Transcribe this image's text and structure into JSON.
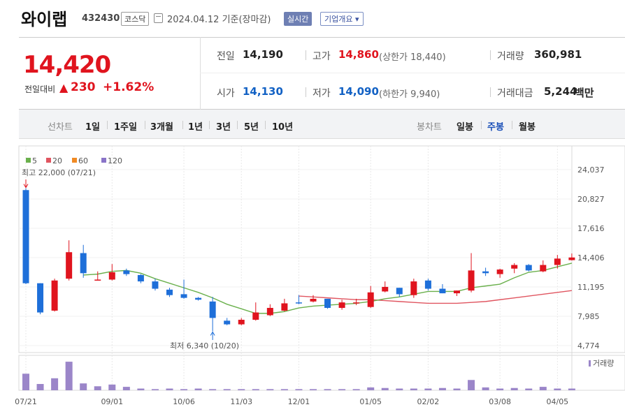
{
  "header": {
    "company": "와이랩",
    "code": "432430",
    "market": "코스닥",
    "date": "2024.04.12 기준(장마감)",
    "realtime": "실시간",
    "overview": "기업개요 ▾"
  },
  "quote": {
    "price": "14,420",
    "change_label": "전일대비",
    "change_arrow": "▲",
    "change": "230",
    "change_pct": "+1.62%",
    "prev_close_label": "전일",
    "prev_close": "14,190",
    "high_label": "고가",
    "high": "14,860",
    "upper_limit": "(상한가 18,440)",
    "volume_label": "거래량",
    "volume": "360,981",
    "open_label": "시가",
    "open": "14,130",
    "low_label": "저가",
    "low": "14,090",
    "lower_limit": "(하한가 9,940)",
    "amount_label": "거래대금",
    "amount": "5,244",
    "amount_unit": "백만"
  },
  "periods": {
    "line_label": "선차트",
    "items": [
      "1일",
      "1주일",
      "3개월",
      "1년",
      "3년",
      "5년",
      "10년"
    ],
    "candle_label": "봉차트",
    "candle_items": [
      "일봉",
      "주봉",
      "월봉"
    ],
    "active_candle": "주봉"
  },
  "colors": {
    "up": "#e0141e",
    "down": "#1e6fd9",
    "ma5": "#6ab04c",
    "ma20": "#e05560",
    "ma60": "#f08a24",
    "ma120": "#8a74c8",
    "volume": "#9b86c9"
  },
  "chart_data": {
    "type": "candlestick",
    "legend": [
      "5",
      "20",
      "60",
      "120"
    ],
    "y_ticks": [
      "24,037",
      "20,827",
      "17,616",
      "14,406",
      "11,195",
      "7,985",
      "4,774"
    ],
    "y_tick_values": [
      24037,
      20827,
      17616,
      14406,
      11195,
      7985,
      4774
    ],
    "x_tick_labels": [
      "07/21",
      "09/01",
      "10/06",
      "11/03",
      "12/01",
      "01/05",
      "02/02",
      "03/08",
      "04/05"
    ],
    "x_tick_index": [
      0,
      6,
      11,
      15,
      19,
      24,
      28,
      33,
      37
    ],
    "high_annotation": "최고 22,000 (07/21)",
    "low_annotation": "최저 6,340 (10/20)",
    "volume_label": "거래량",
    "candles": [
      {
        "o": 21800,
        "h": 22000,
        "l": 11500,
        "c": 11600
      },
      {
        "o": 11600,
        "h": 11600,
        "l": 8200,
        "c": 8400
      },
      {
        "o": 8600,
        "h": 12100,
        "l": 8500,
        "c": 11900
      },
      {
        "o": 12100,
        "h": 16300,
        "l": 11900,
        "c": 15000
      },
      {
        "o": 14900,
        "h": 15800,
        "l": 12200,
        "c": 12700
      },
      {
        "o": 12000,
        "h": 12900,
        "l": 11900,
        "c": 12000
      },
      {
        "o": 12000,
        "h": 13700,
        "l": 11900,
        "c": 12800
      },
      {
        "o": 13000,
        "h": 13200,
        "l": 12400,
        "c": 12600
      },
      {
        "o": 12500,
        "h": 12600,
        "l": 11600,
        "c": 11800
      },
      {
        "o": 11800,
        "h": 12100,
        "l": 10800,
        "c": 11000
      },
      {
        "o": 10900,
        "h": 11100,
        "l": 10100,
        "c": 10300
      },
      {
        "o": 10400,
        "h": 12000,
        "l": 9900,
        "c": 10000
      },
      {
        "o": 10000,
        "h": 10100,
        "l": 9700,
        "c": 9800
      },
      {
        "o": 9600,
        "h": 10100,
        "l": 6340,
        "c": 7800
      },
      {
        "o": 7500,
        "h": 7800,
        "l": 7000,
        "c": 7100
      },
      {
        "o": 7100,
        "h": 7800,
        "l": 7000,
        "c": 7600
      },
      {
        "o": 7600,
        "h": 9500,
        "l": 7500,
        "c": 8400
      },
      {
        "o": 8100,
        "h": 9300,
        "l": 8000,
        "c": 8900
      },
      {
        "o": 8600,
        "h": 9900,
        "l": 8500,
        "c": 9400
      },
      {
        "o": 9500,
        "h": 10300,
        "l": 9300,
        "c": 9400
      },
      {
        "o": 9600,
        "h": 10300,
        "l": 9500,
        "c": 9900
      },
      {
        "o": 9900,
        "h": 9900,
        "l": 8800,
        "c": 8900
      },
      {
        "o": 8900,
        "h": 9800,
        "l": 8700,
        "c": 9500
      },
      {
        "o": 9400,
        "h": 9900,
        "l": 9200,
        "c": 9500
      },
      {
        "o": 9000,
        "h": 11300,
        "l": 8900,
        "c": 10600
      },
      {
        "o": 10700,
        "h": 11800,
        "l": 10600,
        "c": 11200
      },
      {
        "o": 11100,
        "h": 11100,
        "l": 10100,
        "c": 10400
      },
      {
        "o": 10300,
        "h": 12100,
        "l": 10000,
        "c": 11800
      },
      {
        "o": 11900,
        "h": 12100,
        "l": 10800,
        "c": 11000
      },
      {
        "o": 11000,
        "h": 11500,
        "l": 10500,
        "c": 10500
      },
      {
        "o": 10500,
        "h": 10800,
        "l": 10200,
        "c": 10800
      },
      {
        "o": 10800,
        "h": 14900,
        "l": 10600,
        "c": 13000
      },
      {
        "o": 12900,
        "h": 13300,
        "l": 12400,
        "c": 12700
      },
      {
        "o": 12600,
        "h": 13200,
        "l": 12200,
        "c": 13100
      },
      {
        "o": 13200,
        "h": 13800,
        "l": 12700,
        "c": 13600
      },
      {
        "o": 13600,
        "h": 13700,
        "l": 12900,
        "c": 13000
      },
      {
        "o": 12900,
        "h": 14100,
        "l": 12800,
        "c": 13600
      },
      {
        "o": 13600,
        "h": 14700,
        "l": 13200,
        "c": 14300
      },
      {
        "o": 14130,
        "h": 14860,
        "l": 14090,
        "c": 14420
      }
    ],
    "ma5": [
      null,
      null,
      null,
      null,
      12500,
      12600,
      12900,
      13000,
      12700,
      12100,
      11600,
      11100,
      10600,
      10000,
      9300,
      8800,
      8300,
      8300,
      8500,
      8900,
      9100,
      9200,
      9300,
      9400,
      9600,
      9900,
      10100,
      10400,
      10700,
      10700,
      10700,
      11100,
      11300,
      11500,
      12200,
      12800,
      13000,
      13400,
      13800
    ],
    "ma20": [
      null,
      null,
      null,
      null,
      null,
      null,
      null,
      null,
      null,
      null,
      null,
      null,
      null,
      null,
      null,
      null,
      null,
      null,
      null,
      10200,
      10100,
      10000,
      9900,
      9800,
      9800,
      9700,
      9600,
      9500,
      9400,
      9400,
      9400,
      9500,
      9600,
      9800,
      10000,
      10200,
      10400,
      10600,
      10800
    ],
    "volume": [
      29,
      11,
      21,
      50,
      12,
      7,
      10,
      6,
      3,
      2,
      3,
      2,
      3,
      2,
      2,
      2,
      2,
      2,
      2,
      2,
      2,
      2,
      2,
      2,
      5,
      4,
      3,
      3,
      3,
      4,
      3,
      18,
      5,
      3,
      4,
      3,
      6,
      3,
      3
    ]
  }
}
